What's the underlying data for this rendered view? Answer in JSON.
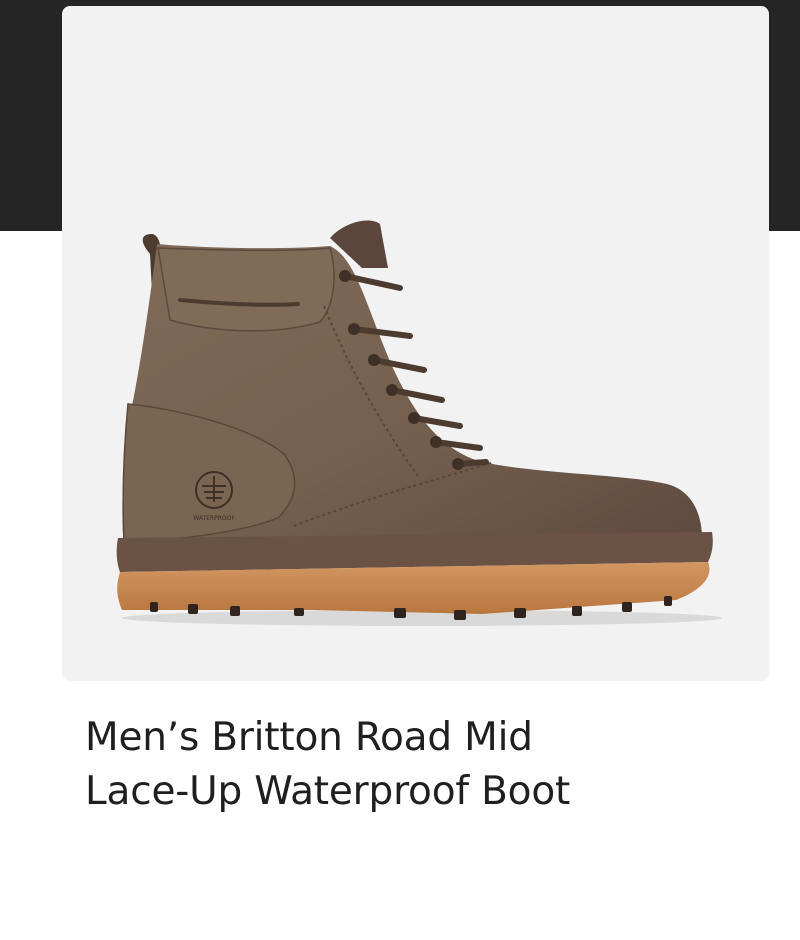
{
  "product": {
    "image": {
      "icon": "boot-image",
      "logo_text": "WATERPROOF",
      "colors": {
        "card_background": "#f2f2f2",
        "leather": "#75604f",
        "leather_dark": "#4d3b30",
        "welt": "#6a5244",
        "outsole": "#c98a55"
      }
    },
    "title_line_1": "Men’s Britton Road Mid",
    "title_line_2": "Lace-Up Waterproof Boot"
  },
  "colors": {
    "page_background": "#ffffff",
    "top_band": "#252525",
    "title_text": "#1f1f1f"
  }
}
